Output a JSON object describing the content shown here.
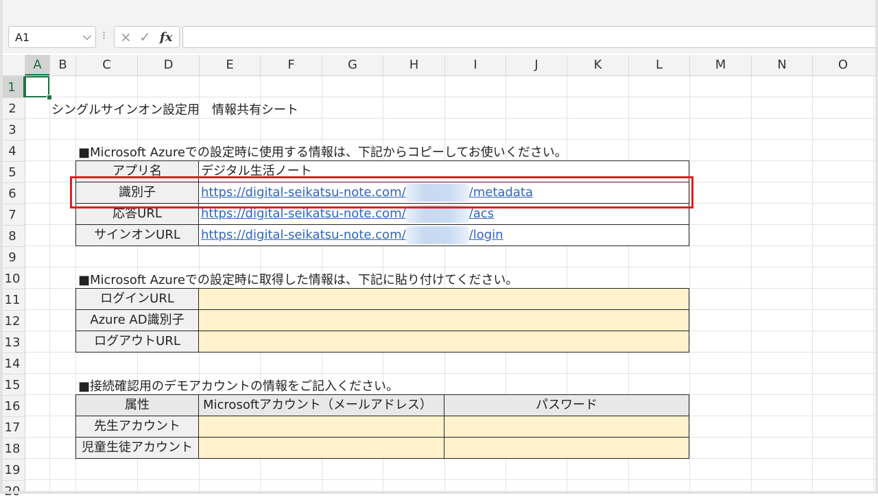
{
  "formula_bar": {
    "name_box": "A1",
    "cancel_icon": "×",
    "enter_icon": "✓",
    "fx_label": "fx",
    "formula_value": ""
  },
  "columns": [
    "A",
    "B",
    "C",
    "D",
    "E",
    "F",
    "G",
    "H",
    "I",
    "J",
    "K",
    "L",
    "M",
    "N",
    "O"
  ],
  "rows": [
    "1",
    "2",
    "3",
    "4",
    "5",
    "6",
    "7",
    "8",
    "9",
    "10",
    "11",
    "12",
    "13",
    "14",
    "15",
    "16",
    "17",
    "18",
    "19",
    "20"
  ],
  "selected_cell": "A1",
  "sheet_title": "シングルサインオン設定用　情報共有シート",
  "section1": {
    "heading": "■Microsoft Azureでの設定時に使用する情報は、下記からコピーしてお使いください。",
    "rows": [
      {
        "label": "アプリ名",
        "value": "デジタル生活ノート"
      },
      {
        "label": "識別子",
        "link_prefix": "https://digital-seikatsu-note.com/",
        "link_suffix": "/metadata"
      },
      {
        "label": "応答URL",
        "link_prefix": "https://digital-seikatsu-note.com/",
        "link_suffix": "/acs"
      },
      {
        "label": "サインオンURL",
        "link_prefix": "https://digital-seikatsu-note.com/",
        "link_suffix": "/login"
      }
    ]
  },
  "section2": {
    "heading": "■Microsoft Azureでの設定時に取得した情報は、下記に貼り付けてください。",
    "rows": [
      {
        "label": "ログインURL",
        "value": ""
      },
      {
        "label": "Azure AD識別子",
        "value": ""
      },
      {
        "label": "ログアウトURL",
        "value": ""
      }
    ]
  },
  "section3": {
    "heading": "■接続確認用のデモアカウントの情報をご記入ください。",
    "headers": [
      "属性",
      "Microsoftアカウント（メールアドレス）",
      "パスワード"
    ],
    "rows": [
      {
        "label": "先生アカウント",
        "account": "",
        "password": ""
      },
      {
        "label": "児童生徒アカウント",
        "account": "",
        "password": ""
      }
    ]
  },
  "colors": {
    "highlight_box": "#e01e1e",
    "input_fill": "#fff2cc",
    "link": "#2f63c4",
    "selection": "#217346"
  }
}
